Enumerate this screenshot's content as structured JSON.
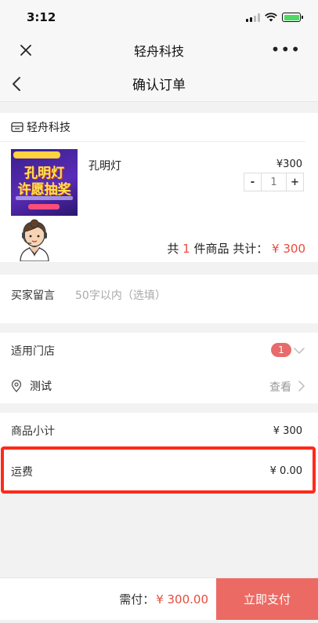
{
  "status_bar": {
    "time": "3:12"
  },
  "title_bar": {
    "title": "轻舟科技"
  },
  "nav_bar": {
    "title": "确认订单"
  },
  "shop": {
    "name": "轻舟科技"
  },
  "product": {
    "name": "孔明灯",
    "price": "¥300",
    "quantity": "1",
    "image_text_line1": "孔明灯",
    "image_text_line2": "许愿抽奖"
  },
  "order_summary": {
    "prefix": "共",
    "count": "1",
    "middle": "件商品 共计：",
    "total": "¥ 300"
  },
  "buyer_note": {
    "label": "买家留言",
    "placeholder": "50字以内（选填）"
  },
  "store": {
    "label": "适用门店",
    "badge_count": "1",
    "store_name": "测试",
    "view_label": "查看"
  },
  "subtotal": {
    "label": "商品小计",
    "value": "¥ 300"
  },
  "shipping": {
    "label": "运费",
    "value": "¥ 0.00"
  },
  "bottom_bar": {
    "pay_label": "需付：",
    "pay_amount": "¥ 300.00",
    "pay_button": "立即支付"
  },
  "colors": {
    "accent_red": "#e84c3d",
    "pay_button": "#eb6a63",
    "badge": "#e96a6a",
    "highlight": "#ff2a1a"
  }
}
